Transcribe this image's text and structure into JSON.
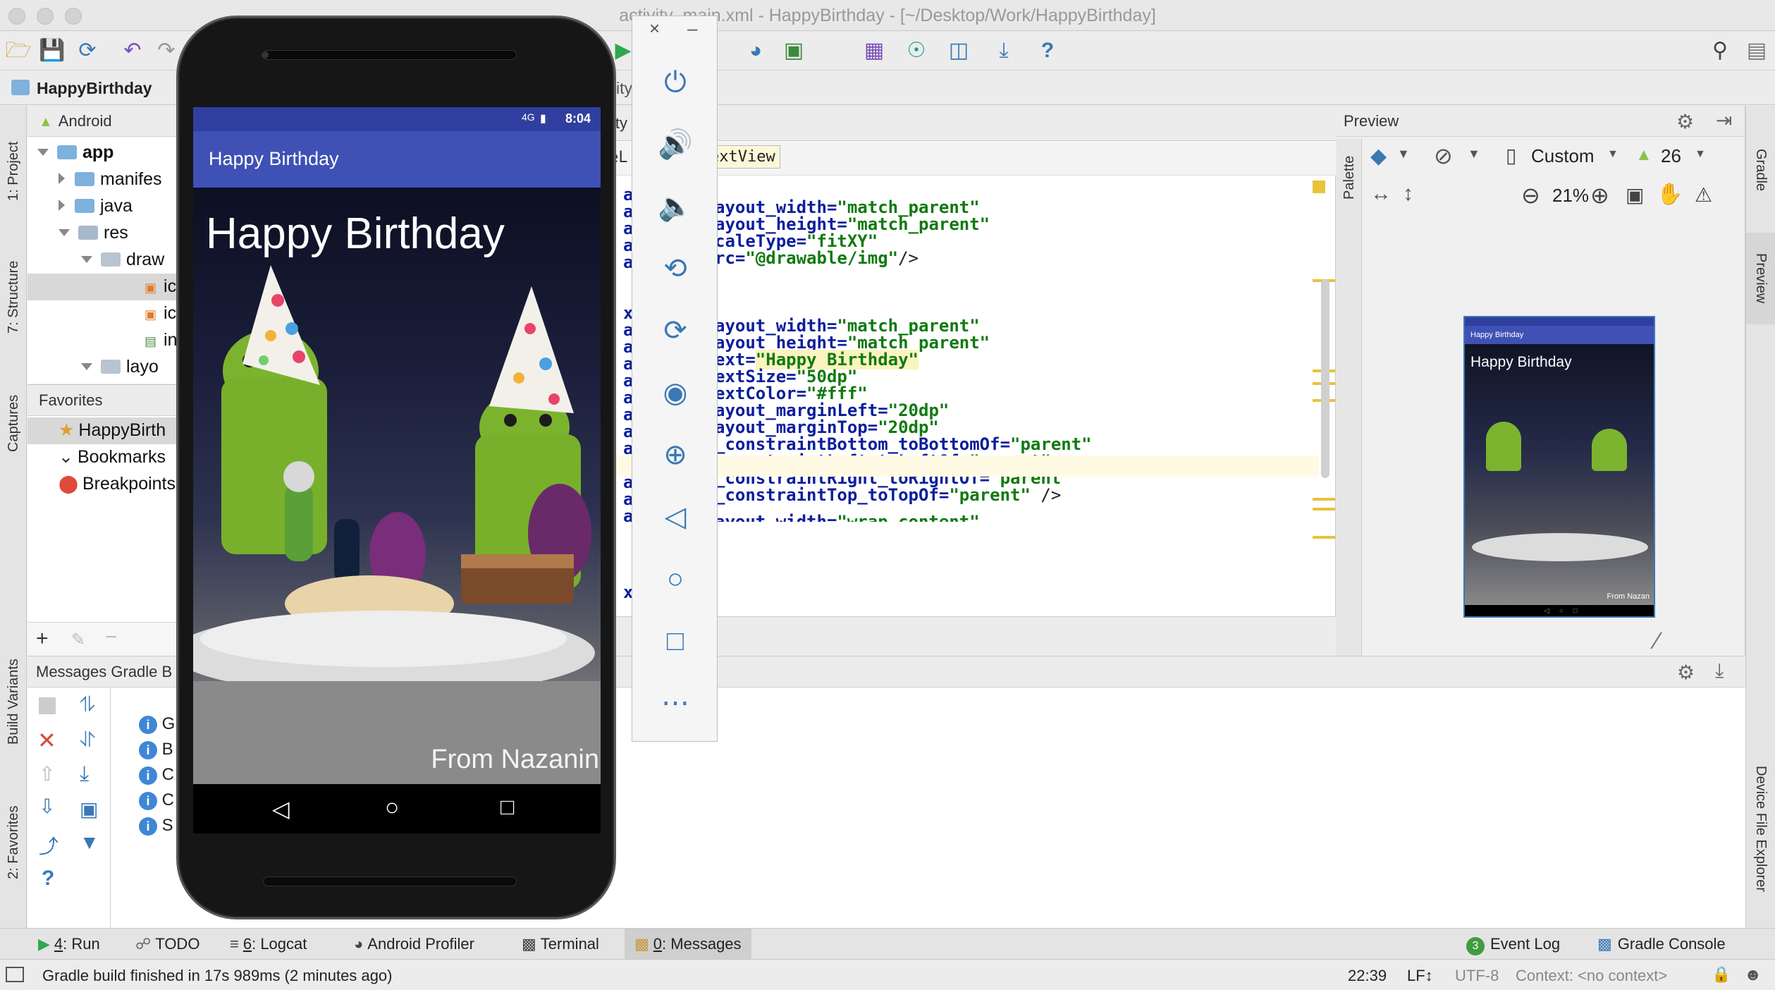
{
  "window": {
    "title": "activity_main.xml - HappyBirthday - [~/Desktop/Work/HappyBirthday]"
  },
  "breadcrumb": {
    "project": "HappyBirthday",
    "partial_tab": "ity"
  },
  "left_strip": {
    "project": "1: Project",
    "structure": "7: Structure",
    "captures": "Captures",
    "build_variants": "Build Variants",
    "favorites": "2: Favorites"
  },
  "project_panel": {
    "header": "Android",
    "items": [
      {
        "label": "app",
        "bold": true
      },
      {
        "label": "manifes"
      },
      {
        "label": "java"
      },
      {
        "label": "res"
      },
      {
        "label": "draw"
      },
      {
        "label": "ic"
      },
      {
        "label": "ic"
      },
      {
        "label": "in"
      },
      {
        "label": "layo"
      }
    ]
  },
  "favorites_panel": {
    "header": "Favorites",
    "items": [
      {
        "label": "HappyBirth"
      },
      {
        "label": "Bookmarks"
      },
      {
        "label": "Breakpoints"
      }
    ]
  },
  "editor": {
    "tab_fragment": "eL",
    "selected_crumb": "extView",
    "gutter": [
      "ag",
      "a",
      "a",
      "a",
      "a",
      "xt",
      "a",
      "a",
      "a",
      "a",
      "a",
      "a",
      "a",
      "a",
      "a",
      "a",
      "a",
      "a",
      "xt"
    ],
    "lines": [
      {
        "attr": "ayout_width=",
        "val": "\"match_parent\""
      },
      {
        "attr": "ayout_height=",
        "val": "\"match_parent\""
      },
      {
        "attr": "caleType=",
        "val": "\"fitXY\""
      },
      {
        "attr": "rc=",
        "val": "\"@drawable/img\"",
        "tail": "/>"
      },
      {
        "attr": "ayout_width=",
        "val": "\"match_parent\""
      },
      {
        "attr": "ayout_height=",
        "val": "\"match_parent\""
      },
      {
        "attr": "ext=",
        "val": "\"Happy Birthday\""
      },
      {
        "attr": "extSize=",
        "val": "\"50dp\""
      },
      {
        "attr": "extColor=",
        "val": "\"#fff\""
      },
      {
        "attr": "ayout_marginLeft=",
        "val": "\"20dp\""
      },
      {
        "attr": "ayout_marginTop=",
        "val": "\"20dp\""
      },
      {
        "attr": "_constraintBottom_toBottomOf=",
        "val": "\"parent\""
      },
      {
        "attr": "_constraintLeft_toLeftOf=",
        "val": "\"parent\""
      },
      {
        "attr": "_constraintRight_toRightOf=",
        "val": "\"parent\""
      },
      {
        "attr": "_constraintTop_toTopOf=",
        "val": "\"parent\"",
        "tail": " />"
      },
      {
        "attr": "ayout_width=",
        "val": "\"wrap_content\""
      }
    ]
  },
  "preview": {
    "header": "Preview",
    "palette": "Palette",
    "device": "Custom",
    "api": "26",
    "zoom": "21%",
    "mini_title": "Happy Birthday",
    "mini_text": "Happy Birthday",
    "mini_footer": "From Nazan"
  },
  "right_strip": {
    "gradle": "Gradle",
    "preview": "Preview",
    "device_explorer": "Device File Explorer"
  },
  "messages": {
    "header": "Messages Gradle B",
    "rows": [
      "G",
      "B",
      "C",
      "C",
      "S"
    ]
  },
  "bottom_tabs": [
    {
      "num": "4",
      "label": ": Run"
    },
    {
      "num": "",
      "label": "TODO"
    },
    {
      "num": "6",
      "label": ": Logcat"
    },
    {
      "num": "",
      "label": "Android Profiler"
    },
    {
      "num": "",
      "label": "Terminal"
    },
    {
      "num": "0",
      "label": ": Messages"
    }
  ],
  "bottom_right": {
    "event_count": "3",
    "event_log": "Event Log",
    "gradle_console": "Gradle Console"
  },
  "status": {
    "message": "Gradle build finished in 17s 989ms (2 minutes ago)",
    "position": "22:39",
    "line_sep": "LF↕",
    "encoding": "UTF-8",
    "context": "Context: <no context>"
  },
  "emulator": {
    "time": "8:04",
    "network": "4G",
    "app_title": "Happy Birthday",
    "headline": "Happy Birthday",
    "footer": "From Nazanin",
    "appbar_color": "#3f51b5",
    "statusbar_color": "#303f9f"
  },
  "colors": {
    "accent": "#3f87d4",
    "attr": "#0b1e9c",
    "value": "#107a10"
  }
}
